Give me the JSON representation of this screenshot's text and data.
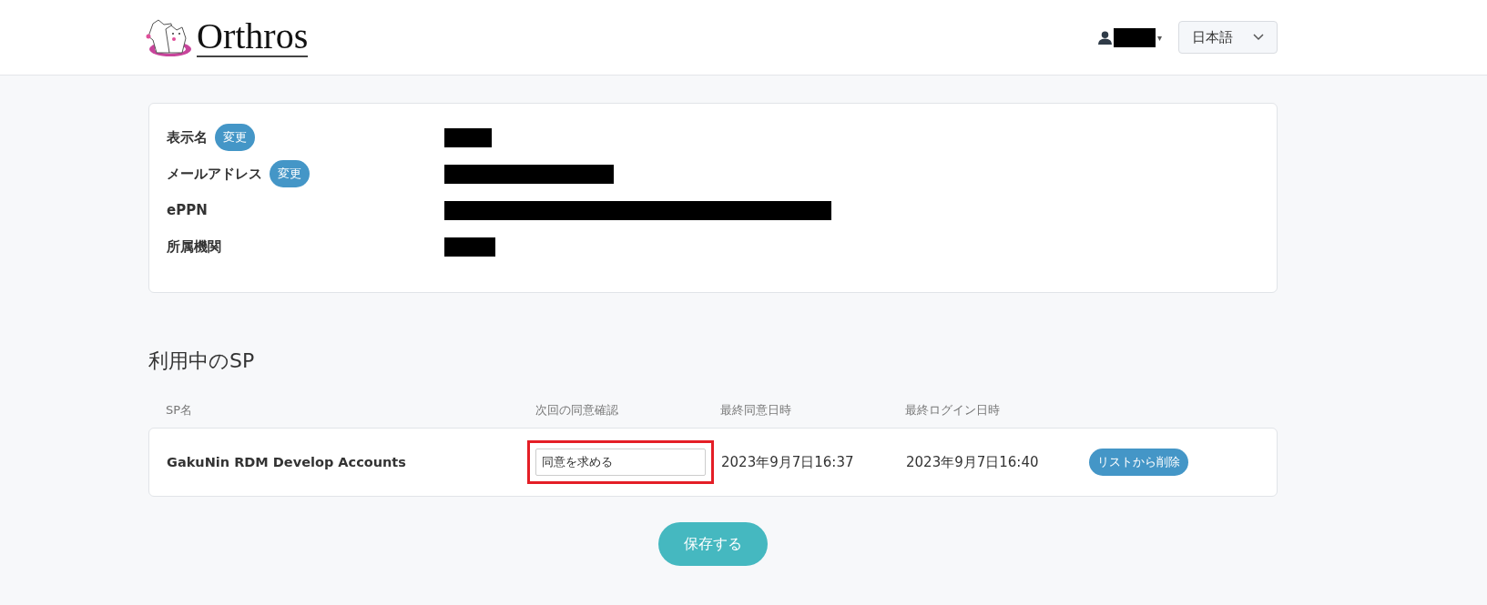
{
  "header": {
    "logo_text": "Orthros",
    "user_menu": {
      "caret": "▾"
    },
    "language": {
      "value": "日本語"
    }
  },
  "profile": [
    {
      "label": "表示名",
      "action": "変更",
      "value": {
        "kind": "redacted"
      }
    },
    {
      "label": "メールアドレス",
      "action": "変更",
      "value": {
        "kind": "redacted"
      }
    },
    {
      "label": "ePPN",
      "value": {
        "kind": "redacted"
      }
    },
    {
      "label": "所属機関",
      "value": {
        "kind": "redacted"
      }
    }
  ],
  "sp_section": {
    "title": "利用中のSP",
    "columns": [
      "SP名",
      "次回の同意確認",
      "最終同意日時",
      "最終ログイン日時"
    ],
    "rows": [
      {
        "name": "GakuNin RDM Develop Accounts",
        "consent": "同意を求める",
        "highlighted": true,
        "last_consent": "2023年9月7日16:37",
        "last_login": "2023年9月7日16:40",
        "action": "リストから削除"
      }
    ]
  },
  "save_button": "保存する"
}
